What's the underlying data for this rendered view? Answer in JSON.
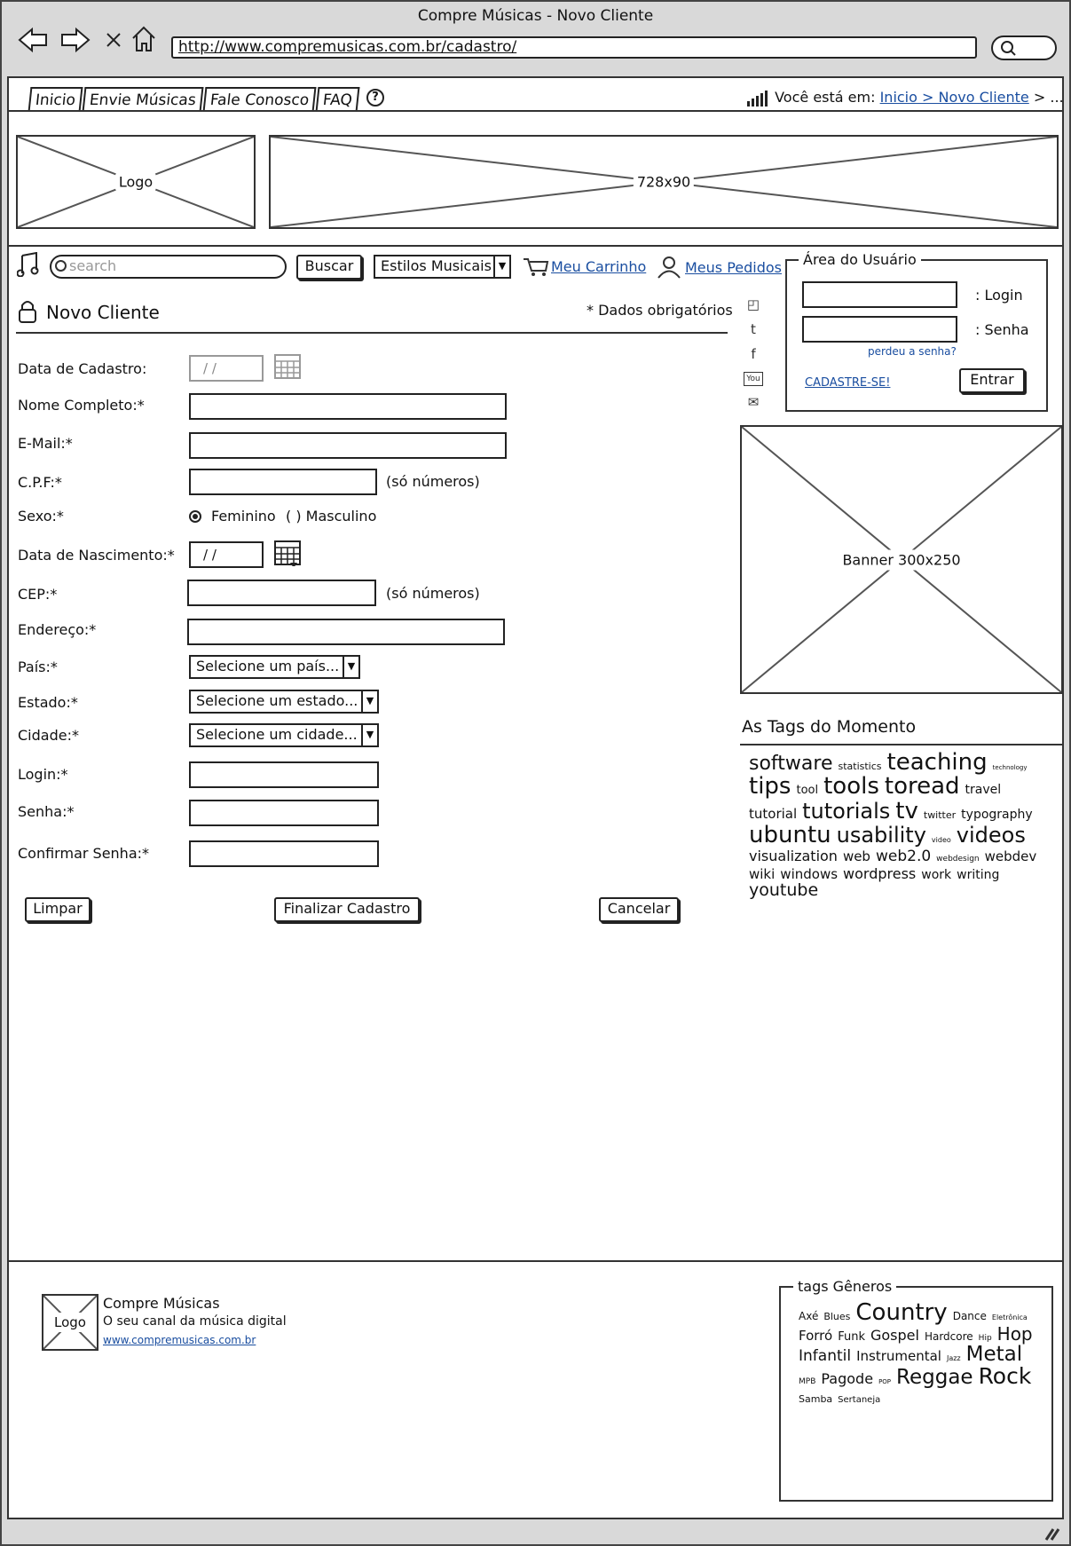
{
  "window": {
    "title": "Compre Músicas - Novo Cliente"
  },
  "browser": {
    "url": "http://www.compremusicas.com.br/cadastro/",
    "nav_icons": [
      "back-arrow-icon",
      "forward-arrow-icon",
      "close-x-icon",
      "home-icon"
    ]
  },
  "nav": {
    "tabs": [
      "Inicio",
      "Envie Músicas",
      "Fale Conosco",
      "FAQ"
    ],
    "breadcrumb_prefix": "Você está em:",
    "breadcrumb_link": "Inicio > Novo Cliente",
    "breadcrumb_more": "> ..."
  },
  "header": {
    "logo_label": "Logo",
    "banner_label": "728x90"
  },
  "toolbar": {
    "search_placeholder": "search",
    "search_button": "Buscar",
    "styles_select": "Estilos Musicais",
    "cart_link": "Meu Carrinho",
    "orders_link": "Meus Pedidos"
  },
  "user_area": {
    "legend": "Área do Usuário",
    "login_label": ": Login",
    "password_label": ": Senha",
    "forgot_link": "perdeu a senha?",
    "signup_link": "CADASTRE-SE!",
    "enter_button": "Entrar"
  },
  "form": {
    "title": "Novo Cliente",
    "required_note": "* Dados obrigatórios",
    "labels": {
      "data_cadastro": "Data de Cadastro:",
      "nome": "Nome Completo:*",
      "email": "E-Mail:*",
      "cpf": "C.P.F:*",
      "sexo": "Sexo:*",
      "nascimento": "Data de Nascimento:*",
      "cep": "CEP:*",
      "endereco": "Endereço:*",
      "pais": "País:*",
      "estado": "Estado:*",
      "cidade": "Cidade:*",
      "login": "Login:*",
      "senha": "Senha:*",
      "confirmar": "Confirmar Senha:*"
    },
    "date_placeholder": "/ /",
    "only_numbers": "(só números)",
    "sexo_feminino": "Feminino",
    "sexo_masculino": "( ) Masculino",
    "pais_select": "Selecione um país...",
    "estado_select": "Selecione um estado...",
    "cidade_select": "Selecione um cidade...",
    "buttons": {
      "limpar": "Limpar",
      "finalizar": "Finalizar Cadastro",
      "cancelar": "Cancelar"
    }
  },
  "sidebar": {
    "social_icons": [
      "rss-icon",
      "twitter-icon",
      "facebook-icon",
      "youtube-icon",
      "email-icon"
    ],
    "social_glyphs": [
      "◰",
      "t",
      "f",
      "You",
      "✉"
    ],
    "banner_label": "Banner 300x250",
    "tags_title": "As Tags do Momento",
    "tags": [
      {
        "t": "software",
        "s": 22
      },
      {
        "t": "statistics",
        "s": 11
      },
      {
        "t": "teaching",
        "s": 26
      },
      {
        "t": "technology",
        "s": 7
      },
      {
        "t": "tips",
        "s": 26
      },
      {
        "t": "tool",
        "s": 13
      },
      {
        "t": "tools",
        "s": 26
      },
      {
        "t": "toread",
        "s": 26
      },
      {
        "t": "travel",
        "s": 14
      },
      {
        "t": "tutorial",
        "s": 15
      },
      {
        "t": "tutorials",
        "s": 24
      },
      {
        "t": "tv",
        "s": 26
      },
      {
        "t": "twitter",
        "s": 11
      },
      {
        "t": "typography",
        "s": 14
      },
      {
        "t": "ubuntu",
        "s": 26
      },
      {
        "t": "usability",
        "s": 24
      },
      {
        "t": "video",
        "s": 8
      },
      {
        "t": "videos",
        "s": 24
      },
      {
        "t": "visualization",
        "s": 16
      },
      {
        "t": "web",
        "s": 15
      },
      {
        "t": "web2.0",
        "s": 17
      },
      {
        "t": "webdesign",
        "s": 9
      },
      {
        "t": "webdev",
        "s": 15
      },
      {
        "t": "wiki",
        "s": 15
      },
      {
        "t": "windows",
        "s": 15
      },
      {
        "t": "wordpress",
        "s": 16
      },
      {
        "t": "work",
        "s": 14
      },
      {
        "t": "writing",
        "s": 14
      },
      {
        "t": "youtube",
        "s": 19
      }
    ]
  },
  "footer": {
    "logo_label": "Logo",
    "site_name": "Compre Músicas",
    "tagline": "O seu canal da música digital",
    "site_url": "www.compremusicas.com.br",
    "genres_legend": "tags Gêneros",
    "genres": [
      {
        "t": "Axé",
        "s": 12
      },
      {
        "t": "Blues",
        "s": 11
      },
      {
        "t": "Country",
        "s": 26
      },
      {
        "t": "Dance",
        "s": 12
      },
      {
        "t": "Eletrônica",
        "s": 8
      },
      {
        "t": "Forró",
        "s": 15
      },
      {
        "t": "Funk",
        "s": 13
      },
      {
        "t": "Gospel",
        "s": 16
      },
      {
        "t": "Hardcore",
        "s": 12
      },
      {
        "t": "Hip",
        "s": 9
      },
      {
        "t": "Hop",
        "s": 20
      },
      {
        "t": "Infantil",
        "s": 17
      },
      {
        "t": "Instrumental",
        "s": 15
      },
      {
        "t": "Jazz",
        "s": 8
      },
      {
        "t": "Metal",
        "s": 23
      },
      {
        "t": "MPB",
        "s": 9
      },
      {
        "t": "Pagode",
        "s": 16
      },
      {
        "t": "POP",
        "s": 7
      },
      {
        "t": "Reggae",
        "s": 23
      },
      {
        "t": "Rock",
        "s": 25
      },
      {
        "t": "Samba",
        "s": 11
      },
      {
        "t": "Sertaneja",
        "s": 10
      }
    ]
  }
}
